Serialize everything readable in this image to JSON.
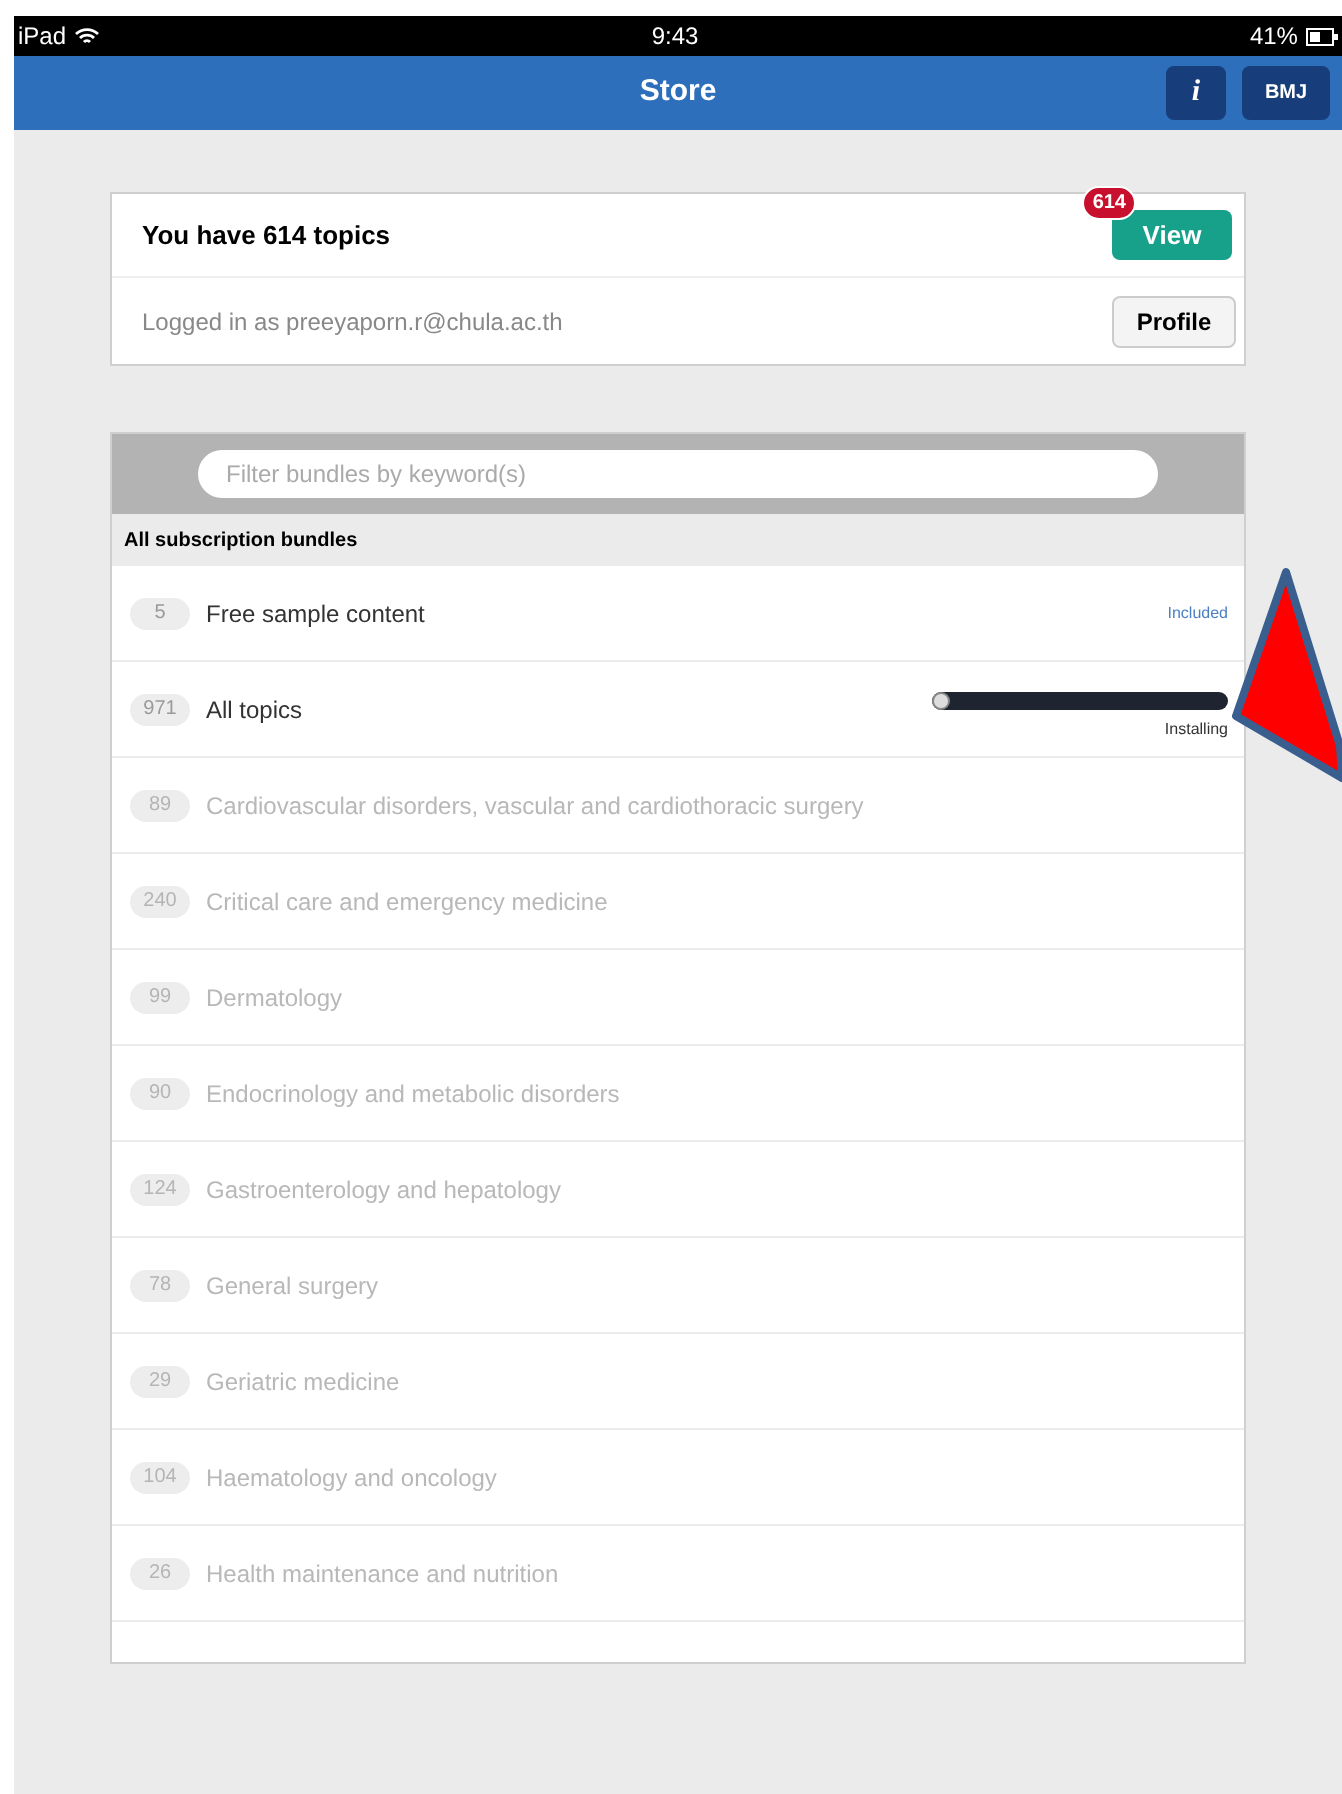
{
  "status_bar": {
    "device": "iPad",
    "time": "9:43",
    "battery": "41%"
  },
  "nav": {
    "title": "Store",
    "info_button": "i",
    "brand_button": "BMJ"
  },
  "summary": {
    "title": "You have 614 topics",
    "badge": "614",
    "view_button": "View",
    "login_text": "Logged in as preeyaporn.r@chula.ac.th",
    "profile_button": "Profile"
  },
  "filter": {
    "placeholder": "Filter bundles by keyword(s)"
  },
  "section_title": "All subscription bundles",
  "bundles": [
    {
      "count": "5",
      "name": "Free sample content",
      "kind": "included",
      "status": "Included",
      "disabled": false
    },
    {
      "count": "971",
      "name": "All topics",
      "kind": "installing",
      "status": "Installing",
      "level": 0.02,
      "disabled": false
    },
    {
      "count": "89",
      "name": "Cardiovascular disorders, vascular and cardiothoracic surgery",
      "kind": "plain",
      "disabled": true
    },
    {
      "count": "240",
      "name": "Critical care and emergency medicine",
      "kind": "plain",
      "disabled": true
    },
    {
      "count": "99",
      "name": "Dermatology",
      "kind": "plain",
      "disabled": true
    },
    {
      "count": "90",
      "name": "Endocrinology and metabolic disorders",
      "kind": "plain",
      "disabled": true
    },
    {
      "count": "124",
      "name": "Gastroenterology and hepatology",
      "kind": "plain",
      "disabled": true
    },
    {
      "count": "78",
      "name": "General surgery",
      "kind": "plain",
      "disabled": true
    },
    {
      "count": "29",
      "name": "Geriatric medicine",
      "kind": "plain",
      "disabled": true
    },
    {
      "count": "104",
      "name": "Haematology and oncology",
      "kind": "plain",
      "disabled": true
    },
    {
      "count": "26",
      "name": "Health maintenance and nutrition",
      "kind": "plain",
      "disabled": true
    }
  ]
}
